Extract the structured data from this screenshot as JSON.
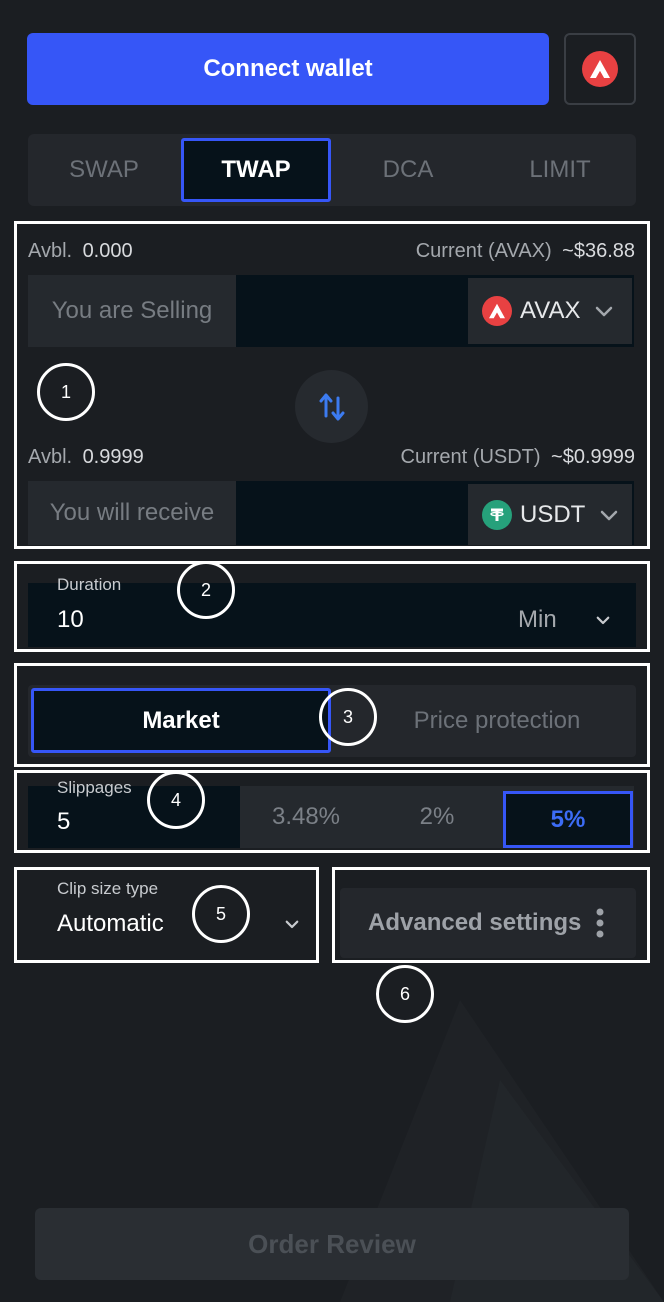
{
  "header": {
    "connect_label": "Connect wallet",
    "network_icon": "avalanche-logo-icon"
  },
  "tabs": [
    {
      "label": "SWAP",
      "active": false
    },
    {
      "label": "TWAP",
      "active": true
    },
    {
      "label": "DCA",
      "active": false
    },
    {
      "label": "LIMIT",
      "active": false
    }
  ],
  "sell": {
    "avbl_label": "Avbl.",
    "avbl_value": "0.000",
    "current_label": "Current (AVAX)",
    "current_value": "~$36.88",
    "placeholder": "You are Selling",
    "token": "AVAX"
  },
  "buy": {
    "avbl_label": "Avbl.",
    "avbl_value": "0.9999",
    "current_label": "Current (USDT)",
    "current_value": "~$0.9999",
    "placeholder": "You will receive",
    "token": "USDT"
  },
  "duration": {
    "label": "Duration",
    "value": "10",
    "unit": "Min"
  },
  "order_type": {
    "market_label": "Market",
    "price_protection_label": "Price protection",
    "selected": "Market"
  },
  "slippage": {
    "label": "Slippages",
    "value": "5",
    "options": [
      "3.48%",
      "2%",
      "5%"
    ],
    "selected": "5%"
  },
  "clip_size": {
    "label": "Clip size type",
    "value": "Automatic"
  },
  "advanced": {
    "label": "Advanced settings"
  },
  "markers": [
    "1",
    "2",
    "3",
    "4",
    "5",
    "6"
  ],
  "footer": {
    "order_review_label": "Order Review"
  },
  "colors": {
    "accent": "#3656f7",
    "background": "#1b1e22",
    "avax": "#e84142",
    "usdt": "#26a17b"
  }
}
